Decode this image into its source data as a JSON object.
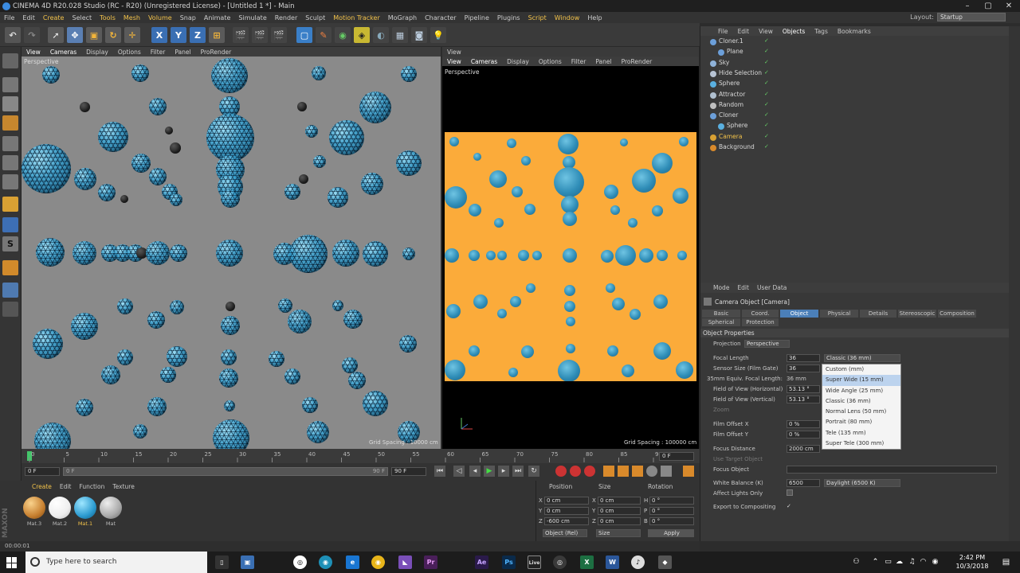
{
  "window": {
    "title": "CINEMA 4D R20.028 Studio (RC - R20) (Unregistered License) - [Untitled 1 *] - Main",
    "minimize": "–",
    "maximize": "▢",
    "close": "✕"
  },
  "menu": {
    "items": [
      "File",
      "Edit",
      "Create",
      "Select",
      "Tools",
      "Mesh",
      "Volume",
      "Snap",
      "Animate",
      "Simulate",
      "Render",
      "Sculpt",
      "Motion Tracker",
      "MoGraph",
      "Character",
      "Pipeline",
      "Plugins",
      "Script",
      "Window",
      "Help"
    ],
    "layout_label": "Layout:",
    "layout_value": "Startup"
  },
  "viewport_left": {
    "menu": [
      "View",
      "Cameras",
      "Display",
      "Options",
      "Filter",
      "Panel",
      "ProRender"
    ],
    "mode": "Perspective",
    "grid_spacing": "Grid Spacing : 10000 cm"
  },
  "viewport_right": {
    "title": "View",
    "menu": [
      "View",
      "Cameras",
      "Display",
      "Options",
      "Filter",
      "Panel",
      "ProRender"
    ],
    "mode": "Perspective",
    "grid_spacing": "Grid Spacing : 100000 cm"
  },
  "timeline": {
    "ticks": [
      "0",
      "5",
      "10",
      "15",
      "20",
      "25",
      "30",
      "35",
      "40",
      "45",
      "50",
      "55",
      "60",
      "65",
      "70",
      "75",
      "80",
      "85",
      "90"
    ],
    "current_frame": "0 F",
    "start_field": "0 F",
    "min_field": "0 F",
    "max_field": "90 F",
    "end_field": "90 F"
  },
  "materials": {
    "menu": [
      "Create",
      "Edit",
      "Function",
      "Texture"
    ],
    "items": [
      "Mat.3",
      "Mat.2",
      "Mat.1",
      "Mat"
    ]
  },
  "coordinates": {
    "headers": [
      "Position",
      "Size",
      "Rotation"
    ],
    "rows": [
      {
        "axis": "X",
        "pos": "0 cm",
        "size_axis": "X",
        "size": "0 cm",
        "rot_axis": "H",
        "rot": "0 °"
      },
      {
        "axis": "Y",
        "pos": "0 cm",
        "size_axis": "Y",
        "size": "0 cm",
        "rot_axis": "P",
        "rot": "0 °"
      },
      {
        "axis": "Z",
        "pos": "-600 cm",
        "size_axis": "Z",
        "size": "0 cm",
        "rot_axis": "B",
        "rot": "0 °"
      }
    ],
    "mode_object": "Object (Rel)",
    "mode_size": "Size",
    "apply": "Apply"
  },
  "status": "00:00:01",
  "object_manager": {
    "menu": [
      "File",
      "Edit",
      "View",
      "Objects",
      "Tags",
      "Bookmarks"
    ],
    "objects": [
      {
        "name": "Cloner.1",
        "indent": 0
      },
      {
        "name": "Plane",
        "indent": 1
      },
      {
        "name": "Sky",
        "indent": 0
      },
      {
        "name": "Hide Selection",
        "indent": 0
      },
      {
        "name": "Sphere",
        "indent": 0
      },
      {
        "name": "Attractor",
        "indent": 0
      },
      {
        "name": "Random",
        "indent": 0
      },
      {
        "name": "Cloner",
        "indent": 0
      },
      {
        "name": "Sphere",
        "indent": 1
      },
      {
        "name": "Camera",
        "indent": 0
      },
      {
        "name": "Background",
        "indent": 0
      }
    ]
  },
  "attributes": {
    "menu": [
      "Mode",
      "Edit",
      "User Data"
    ],
    "title": "Camera Object [Camera]",
    "tabs_row1": [
      "Basic",
      "Coord.",
      "Object",
      "Physical",
      "Details",
      "Stereoscopic",
      "Composition"
    ],
    "tabs_row2": [
      "Spherical",
      "Protection"
    ],
    "active_tab": "Object",
    "section": "Object Properties",
    "projection_label": "Projection",
    "projection_value": "Perspective",
    "focal_length_label": "Focal Length",
    "focal_length_value": "36",
    "focal_preset": "Classic (36 mm)",
    "sensor_label": "Sensor Size (Film Gate)",
    "sensor_value": "36",
    "equiv_label": "35mm Equiv. Focal Length:",
    "equiv_value": "36 mm",
    "fov_h_label": "Field of View (Horizontal)",
    "fov_h_value": "53.13 °",
    "fov_v_label": "Field of View (Vertical)",
    "fov_v_value": "53.13 °",
    "zoom_label": "Zoom",
    "film_x_label": "Film Offset X",
    "film_x_value": "0 %",
    "film_y_label": "Film Offset Y",
    "film_y_value": "0 %",
    "focus_dist_label": "Focus Distance",
    "focus_dist_value": "2000 cm",
    "use_target_label": "Use Target Object",
    "focus_obj_label": "Focus Object",
    "wb_label": "White Balance (K)",
    "wb_value": "6500",
    "wb_preset": "Daylight (6500 K)",
    "affect_label": "Affect Lights Only",
    "export_label": "Export to Compositing",
    "dropdown_options": [
      "Custom (mm)",
      "Super Wide (15 mm)",
      "Wide Angle (25 mm)",
      "Classic (36 mm)",
      "Normal Lens (50 mm)",
      "Portrait (80 mm)",
      "Tele (135 mm)",
      "Super Tele (300 mm)"
    ],
    "dropdown_highlight": "Super Wide (15 mm)"
  },
  "taskbar": {
    "search_placeholder": "Type here to search",
    "time": "2:42 PM",
    "date": "10/3/2018"
  }
}
